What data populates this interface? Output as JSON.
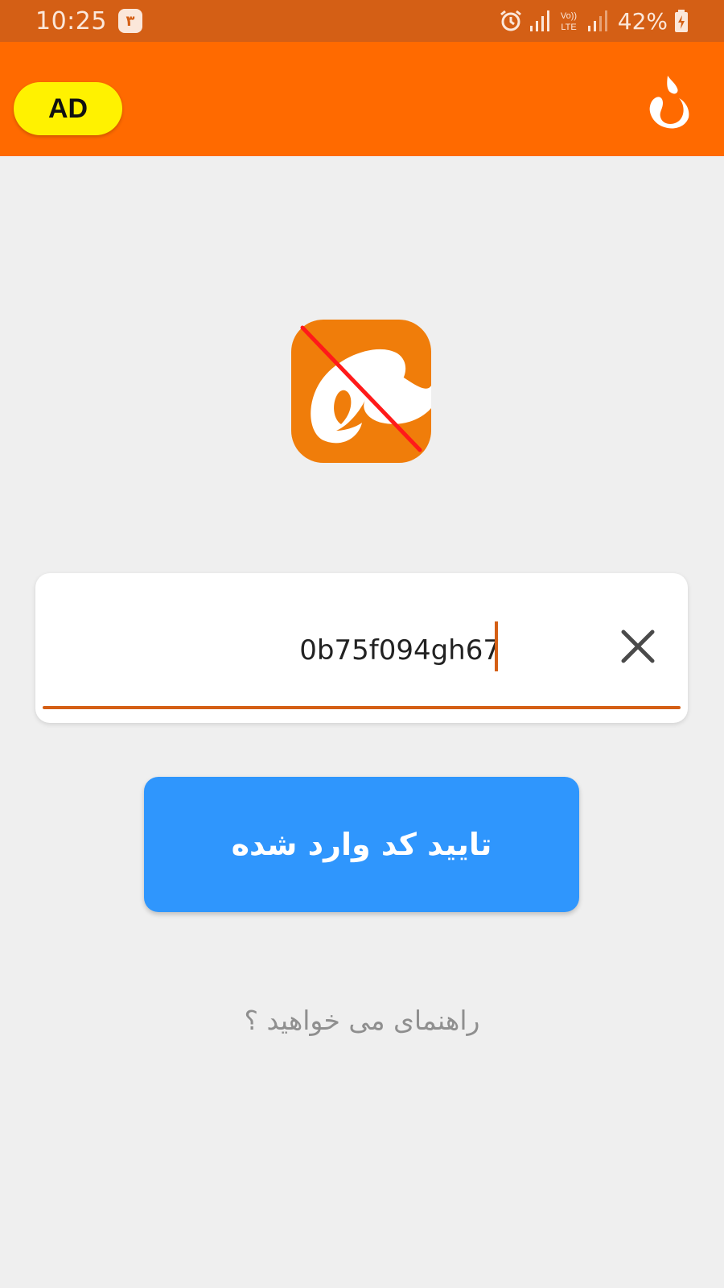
{
  "status_bar": {
    "time": "10:25",
    "notification_badge": "٣",
    "battery": "42%",
    "icons": [
      "alarm-icon",
      "signal-icon",
      "volte-icon",
      "signal-icon",
      "battery-charging-icon"
    ]
  },
  "app_bar": {
    "ad_label": "AD",
    "brand_icon": "flame-logo-icon",
    "color": "#ff6a00"
  },
  "logo": {
    "icon": "app-logo-icon",
    "crossed_out": true,
    "color": "#f07d0a"
  },
  "code_entry": {
    "value": "0b75f094gh67",
    "clear_icon": "close-icon",
    "accent": "#d45f15"
  },
  "confirm": {
    "label": "تایید کد وارد شده",
    "color": "#2f96fd"
  },
  "help": {
    "label": "راهنمای می خواهید ؟"
  }
}
